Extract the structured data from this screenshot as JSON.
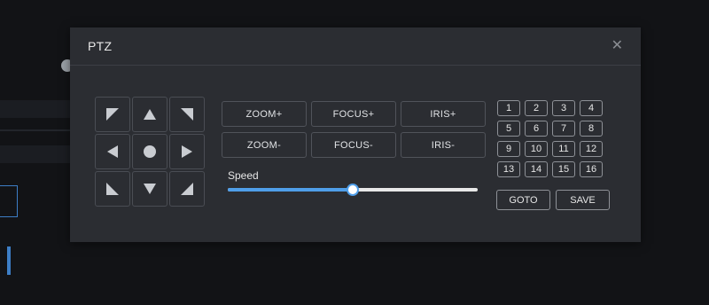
{
  "dialog": {
    "title": "PTZ",
    "close_symbol": "✕"
  },
  "dpad": {
    "buttons": [
      {
        "name": "pan-up-left-button",
        "icon": "arrow-up-left-icon"
      },
      {
        "name": "tilt-up-button",
        "icon": "arrow-up-icon"
      },
      {
        "name": "pan-up-right-button",
        "icon": "arrow-up-right-icon"
      },
      {
        "name": "pan-left-button",
        "icon": "arrow-left-icon"
      },
      {
        "name": "home-button",
        "icon": "circle-icon"
      },
      {
        "name": "pan-right-button",
        "icon": "arrow-right-icon"
      },
      {
        "name": "pan-down-left-button",
        "icon": "arrow-down-left-icon"
      },
      {
        "name": "tilt-down-button",
        "icon": "arrow-down-icon"
      },
      {
        "name": "pan-down-right-button",
        "icon": "arrow-down-right-icon"
      }
    ]
  },
  "functions": [
    "ZOOM+",
    "FOCUS+",
    "IRIS+",
    "ZOOM-",
    "FOCUS-",
    "IRIS-"
  ],
  "speed": {
    "label": "Speed",
    "value": 0.5
  },
  "presets": {
    "numbers": [
      "1",
      "2",
      "3",
      "4",
      "5",
      "6",
      "7",
      "8",
      "9",
      "10",
      "11",
      "12",
      "13",
      "14",
      "15",
      "16"
    ],
    "goto_label": "GOTO",
    "save_label": "SAVE"
  },
  "colors": {
    "accent": "#4f9ee9",
    "dialog_bg": "#2b2d32",
    "page_bg": "#121316"
  }
}
